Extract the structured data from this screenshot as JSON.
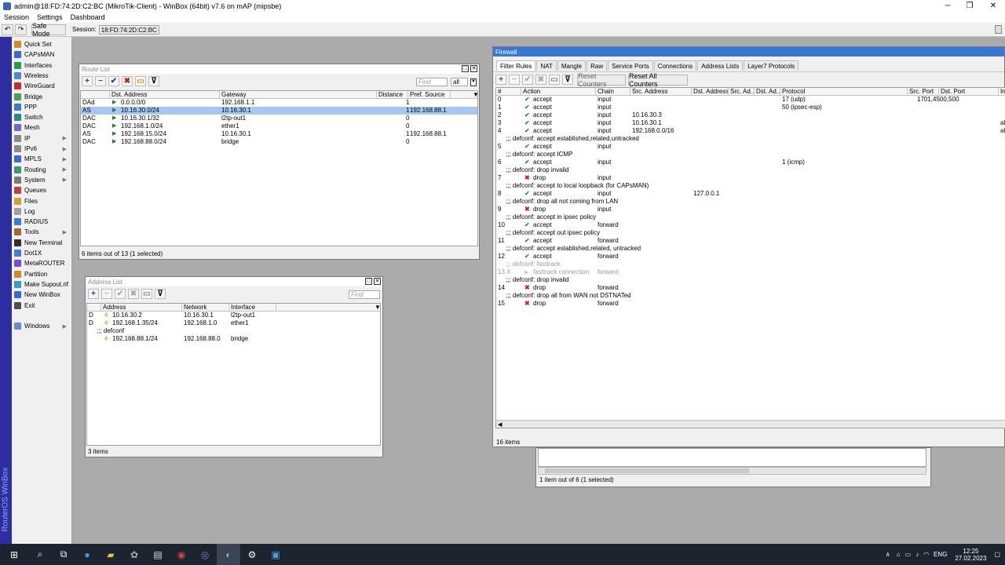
{
  "window_title": "admin@18:FD:74:2D:C2:BC (MikroTik-Client) - WinBox (64bit) v7.6 on mAP (mipsbe)",
  "menu": [
    "Session",
    "Settings",
    "Dashboard"
  ],
  "toolbar": {
    "undo": "↶",
    "redo": "↷",
    "safe_mode": "Safe Mode",
    "session_label": "Session:",
    "session_value": "18:FD:74:2D:C2:BC"
  },
  "sidebar": {
    "vertical_text": "RouterOS WinBox",
    "items": [
      {
        "label": "Quick Set",
        "icon": "wand-icon",
        "color": "#d08a2a",
        "arrow": false
      },
      {
        "label": "CAPsMAN",
        "icon": "caps-icon",
        "color": "#3a6ad0",
        "arrow": false
      },
      {
        "label": "Interfaces",
        "icon": "interfaces-icon",
        "color": "#2a9a4a",
        "arrow": false
      },
      {
        "label": "Wireless",
        "icon": "wireless-icon",
        "color": "#4a8ad0",
        "arrow": false
      },
      {
        "label": "WireGuard",
        "icon": "wireguard-icon",
        "color": "#c03030",
        "arrow": false
      },
      {
        "label": "Bridge",
        "icon": "bridge-icon",
        "color": "#4aa04a",
        "arrow": false
      },
      {
        "label": "PPP",
        "icon": "ppp-icon",
        "color": "#3a7ad0",
        "arrow": false
      },
      {
        "label": "Switch",
        "icon": "switch-icon",
        "color": "#2a8a8a",
        "arrow": false
      },
      {
        "label": "Mesh",
        "icon": "mesh-icon",
        "color": "#6a6ad0",
        "arrow": false
      },
      {
        "label": "IP",
        "icon": "ip-icon",
        "color": "#8a8a8a",
        "arrow": true
      },
      {
        "label": "IPv6",
        "icon": "ipv6-icon",
        "color": "#8a8a8a",
        "arrow": true
      },
      {
        "label": "MPLS",
        "icon": "mpls-icon",
        "color": "#3a6ad0",
        "arrow": true
      },
      {
        "label": "Routing",
        "icon": "routing-icon",
        "color": "#3a9a6a",
        "arrow": true
      },
      {
        "label": "System",
        "icon": "system-icon",
        "color": "#7a7a7a",
        "arrow": true
      },
      {
        "label": "Queues",
        "icon": "queues-icon",
        "color": "#c04040",
        "arrow": false
      },
      {
        "label": "Files",
        "icon": "files-icon",
        "color": "#d0a030",
        "arrow": false
      },
      {
        "label": "Log",
        "icon": "log-icon",
        "color": "#a0a0a0",
        "arrow": false
      },
      {
        "label": "RADIUS",
        "icon": "radius-icon",
        "color": "#3a7ad0",
        "arrow": false
      },
      {
        "label": "Tools",
        "icon": "tools-icon",
        "color": "#9a6a3a",
        "arrow": true
      },
      {
        "label": "New Terminal",
        "icon": "terminal-icon",
        "color": "#303030",
        "arrow": false
      },
      {
        "label": "Dot1X",
        "icon": "dot1x-icon",
        "color": "#4a7ad0",
        "arrow": false
      },
      {
        "label": "MetaROUTER",
        "icon": "metarouter-icon",
        "color": "#7a4ad0",
        "arrow": false
      },
      {
        "label": "Partition",
        "icon": "partition-icon",
        "color": "#d08a2a",
        "arrow": false
      },
      {
        "label": "Make Supout.rif",
        "icon": "supout-icon",
        "color": "#3a9ad0",
        "arrow": false
      },
      {
        "label": "New WinBox",
        "icon": "winbox-icon",
        "color": "#3a6ad0",
        "arrow": false
      },
      {
        "label": "Exit",
        "icon": "exit-icon",
        "color": "#505050",
        "arrow": false
      }
    ],
    "windows_label": "Windows"
  },
  "route_list": {
    "title": "Route List",
    "find": "Find",
    "filter_value": "all",
    "columns": [
      "",
      "Dst. Address",
      "Gateway",
      "Distance",
      "Pref. Source"
    ],
    "rows": [
      {
        "flags": "DAd",
        "dst": "0.0.0.0/0",
        "gw": "192.168.1.1",
        "dist": "1",
        "pref": "",
        "sel": false
      },
      {
        "flags": "AS",
        "dst": "10.16.30.0/24",
        "gw": "10.16.30.1",
        "dist": "1",
        "pref": "192.168.88.1",
        "sel": true
      },
      {
        "flags": "DAC",
        "dst": "10.16.30.1/32",
        "gw": "l2tp-out1",
        "dist": "0",
        "pref": "",
        "sel": false
      },
      {
        "flags": "DAC",
        "dst": "192.168.1.0/24",
        "gw": "ether1",
        "dist": "0",
        "pref": "",
        "sel": false
      },
      {
        "flags": "AS",
        "dst": "192.168.15.0/24",
        "gw": "10.16.30.1",
        "dist": "1",
        "pref": "192.168.88.1",
        "sel": false
      },
      {
        "flags": "DAC",
        "dst": "192.168.88.0/24",
        "gw": "bridge",
        "dist": "0",
        "pref": "",
        "sel": false
      }
    ],
    "status": "6 items out of 13 (1 selected)"
  },
  "address_list": {
    "title": "Address List",
    "find": "Find",
    "columns": [
      "",
      "Address",
      "Network",
      "Interface"
    ],
    "rows": [
      {
        "flag": "D",
        "comment": "",
        "addr": "10.16.30.2",
        "net": "10.16.30.1",
        "iface": "l2tp-out1"
      },
      {
        "flag": "D",
        "comment": "",
        "addr": "192.168.1.35/24",
        "net": "192.168.1.0",
        "iface": "ether1"
      },
      {
        "flag": "",
        "comment": ";;; defconf",
        "addr": "",
        "net": "",
        "iface": ""
      },
      {
        "flag": "",
        "comment": "",
        "addr": "192.168.88.1/24",
        "net": "192.168.88.0",
        "iface": "bridge"
      }
    ],
    "status": "3 items"
  },
  "back_window_status": "1 item out of 6 (1 selected)",
  "firewall": {
    "title": "Firewall",
    "tabs": [
      "Filter Rules",
      "NAT",
      "Mangle",
      "Raw",
      "Service Ports",
      "Connections",
      "Address Lists",
      "Layer7 Protocols"
    ],
    "reset_counters": "Reset Counters",
    "reset_all_counters": "Reset All Counters",
    "columns": [
      "#",
      "Action",
      "Chain",
      "Src. Address",
      "Dst. Address",
      "Src. Ad...",
      "Dst. Ad...",
      "Protocol",
      "Src. Port",
      "Dst. Port",
      "In"
    ],
    "rows": [
      {
        "n": "0",
        "act": "accept",
        "chain": "input",
        "src": "",
        "dst": "",
        "proto": "17 (udp)",
        "dport": "1701,4500,500",
        "in": "",
        "type": "rule"
      },
      {
        "n": "1",
        "act": "accept",
        "chain": "input",
        "src": "",
        "dst": "",
        "proto": "50 (ipsec-esp)",
        "dport": "",
        "in": "",
        "type": "rule"
      },
      {
        "n": "2",
        "act": "accept",
        "chain": "input",
        "src": "10.16.30.3",
        "dst": "",
        "proto": "",
        "dport": "",
        "in": "",
        "type": "rule"
      },
      {
        "n": "3",
        "act": "accept",
        "chain": "input",
        "src": "10.16.30.1",
        "dst": "",
        "proto": "",
        "dport": "",
        "in": "all",
        "type": "rule"
      },
      {
        "n": "4",
        "act": "accept",
        "chain": "input",
        "src": "192.168.0.0/16",
        "dst": "",
        "proto": "",
        "dport": "",
        "in": "all",
        "type": "rule"
      },
      {
        "text": ";;; defconf: accept established,related,untracked",
        "type": "comment"
      },
      {
        "n": "5",
        "act": "accept",
        "chain": "input",
        "src": "",
        "dst": "",
        "proto": "",
        "dport": "",
        "in": "",
        "type": "rule"
      },
      {
        "text": ";;; defconf: accept ICMP",
        "type": "comment"
      },
      {
        "n": "6",
        "act": "accept",
        "chain": "input",
        "src": "",
        "dst": "",
        "proto": "1 (icmp)",
        "dport": "",
        "in": "",
        "type": "rule"
      },
      {
        "text": ";;; defconf: drop invalid",
        "type": "comment"
      },
      {
        "n": "7",
        "act": "drop",
        "chain": "input",
        "src": "",
        "dst": "",
        "proto": "",
        "dport": "",
        "in": "",
        "type": "rule"
      },
      {
        "text": ";;; defconf: accept to local loopback (for CAPsMAN)",
        "type": "comment"
      },
      {
        "n": "8",
        "act": "accept",
        "chain": "input",
        "src": "",
        "dst": "127.0.0.1",
        "proto": "",
        "dport": "",
        "in": "",
        "type": "rule"
      },
      {
        "text": ";;; defconf: drop all not coming from LAN",
        "type": "comment"
      },
      {
        "n": "9",
        "act": "drop",
        "chain": "input",
        "src": "",
        "dst": "",
        "proto": "",
        "dport": "",
        "in": "",
        "type": "rule"
      },
      {
        "text": ";;; defconf: accept in ipsec policy",
        "type": "comment"
      },
      {
        "n": "10",
        "act": "accept",
        "chain": "forward",
        "src": "",
        "dst": "",
        "proto": "",
        "dport": "",
        "in": "",
        "type": "rule"
      },
      {
        "text": ";;; defconf: accept out ipsec policy",
        "type": "comment"
      },
      {
        "n": "11",
        "act": "accept",
        "chain": "forward",
        "src": "",
        "dst": "",
        "proto": "",
        "dport": "",
        "in": "",
        "type": "rule"
      },
      {
        "text": ";;; defconf: accept established,related, untracked",
        "type": "comment"
      },
      {
        "n": "12",
        "act": "accept",
        "chain": "forward",
        "src": "",
        "dst": "",
        "proto": "",
        "dport": "",
        "in": "",
        "type": "rule"
      },
      {
        "text": ";;; defconf: fasttrack",
        "type": "dcomment"
      },
      {
        "n": "13 X",
        "act": "fasttrack connection",
        "chain": "forward",
        "src": "",
        "dst": "",
        "proto": "",
        "dport": "",
        "in": "",
        "type": "disabled"
      },
      {
        "text": ";;; defconf: drop invalid",
        "type": "comment"
      },
      {
        "n": "14",
        "act": "drop",
        "chain": "forward",
        "src": "",
        "dst": "",
        "proto": "",
        "dport": "",
        "in": "",
        "type": "rule"
      },
      {
        "text": ";;; defconf: drop all from WAN not DSTNATed",
        "type": "comment"
      },
      {
        "n": "15",
        "act": "drop",
        "chain": "forward",
        "src": "",
        "dst": "",
        "proto": "",
        "dport": "",
        "in": "",
        "type": "rule"
      }
    ],
    "status": "16 items"
  },
  "taskbar": {
    "lang": "ENG",
    "time": "12:25",
    "date": "27.02.2023"
  }
}
